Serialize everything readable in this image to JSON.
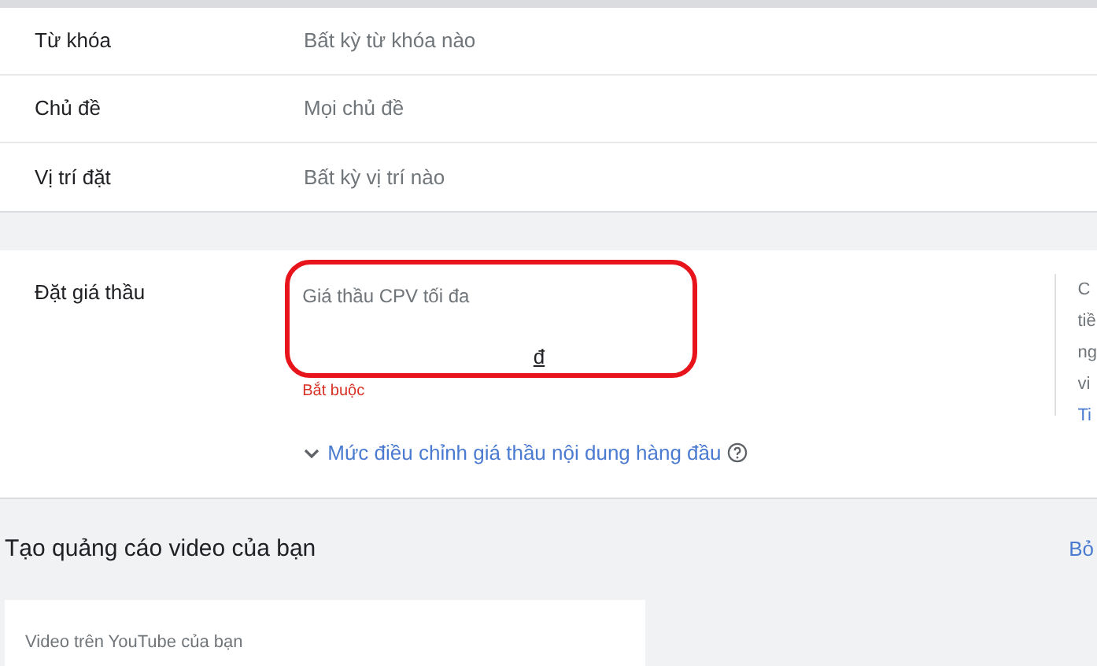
{
  "targeting_rows": [
    {
      "label": "Từ khóa",
      "value": "Bất kỳ từ khóa nào"
    },
    {
      "label": "Chủ đề",
      "value": "Mọi chủ đề"
    },
    {
      "label": "Vị trí đặt",
      "value": "Bất kỳ vị trí nào"
    }
  ],
  "bidding": {
    "label": "Đặt giá thầu",
    "field_label": "Giá thầu CPV tối đa",
    "currency": "đ",
    "error": "Bắt buộc",
    "adjust_link": "Mức điều chỉnh giá thầu nội dung hàng đầu",
    "side_text": [
      "C",
      "tiề",
      "ng",
      "vi"
    ],
    "side_link": "Ti"
  },
  "create_section": {
    "title": "Tạo quảng cáo video của bạn",
    "action": "Bỏ",
    "video_card_label": "Video trên YouTube của bạn"
  }
}
